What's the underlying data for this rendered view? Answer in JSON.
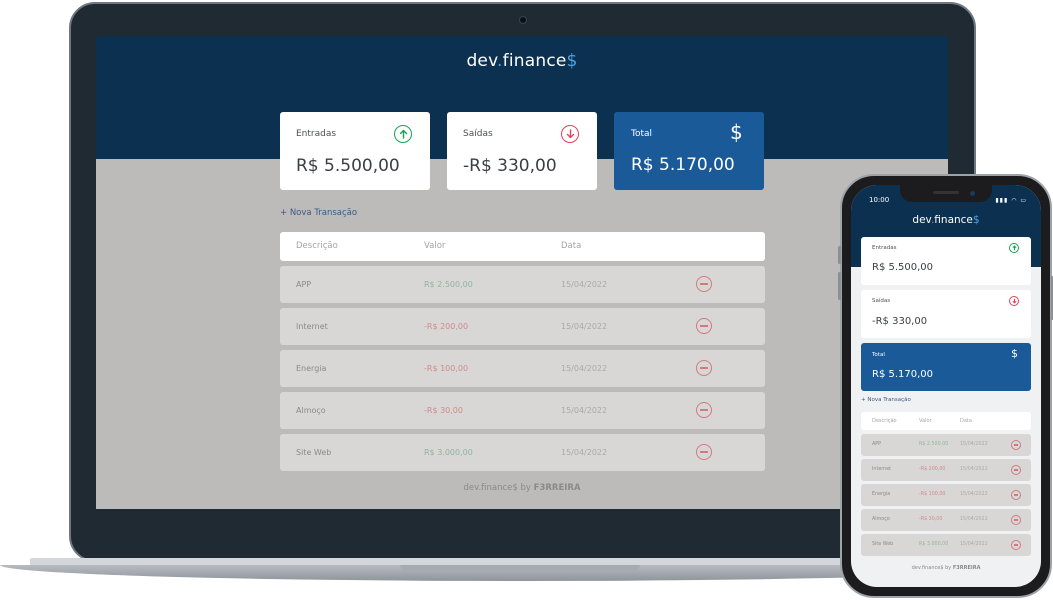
{
  "app": {
    "logo_main": "dev",
    "logo_dot": ".",
    "logo_rest": "finance",
    "logo_dollar": "$"
  },
  "summary": {
    "income_label": "Entradas",
    "income_value": "R$ 5.500,00",
    "expense_label": "Saídas",
    "expense_value": "-R$ 330,00",
    "total_label": "Total",
    "total_value": "R$ 5.170,00",
    "total_icon": "$"
  },
  "new_transaction_label": "+ Nova Transação",
  "table": {
    "headers": [
      "Descrição",
      "Valor",
      "Data"
    ],
    "rows": [
      {
        "description": "APP",
        "amount": "R$ 2.500,00",
        "date": "15/04/2022",
        "type": "income"
      },
      {
        "description": "Internet",
        "amount": "-R$ 200,00",
        "date": "15/04/2022",
        "type": "expense"
      },
      {
        "description": "Energia",
        "amount": "-R$ 100,00",
        "date": "15/04/2022",
        "type": "expense"
      },
      {
        "description": "Almoço",
        "amount": "-R$ 30,00",
        "date": "15/04/2022",
        "type": "expense"
      },
      {
        "description": "Site Web",
        "amount": "R$ 3.000,00",
        "date": "15/04/2022",
        "type": "income"
      }
    ]
  },
  "footer": {
    "prefix": "dev.finance$ by ",
    "author": "F3RREIRA"
  },
  "phone": {
    "status_time": "10:00",
    "status_icons": "▮▮▮ ◠ ▭"
  },
  "colors": {
    "header_bg": "#0c3150",
    "accent": "#4ea0e6",
    "income": "#12a454",
    "expense": "#e83f5b",
    "total_card": "#1a5a98"
  }
}
